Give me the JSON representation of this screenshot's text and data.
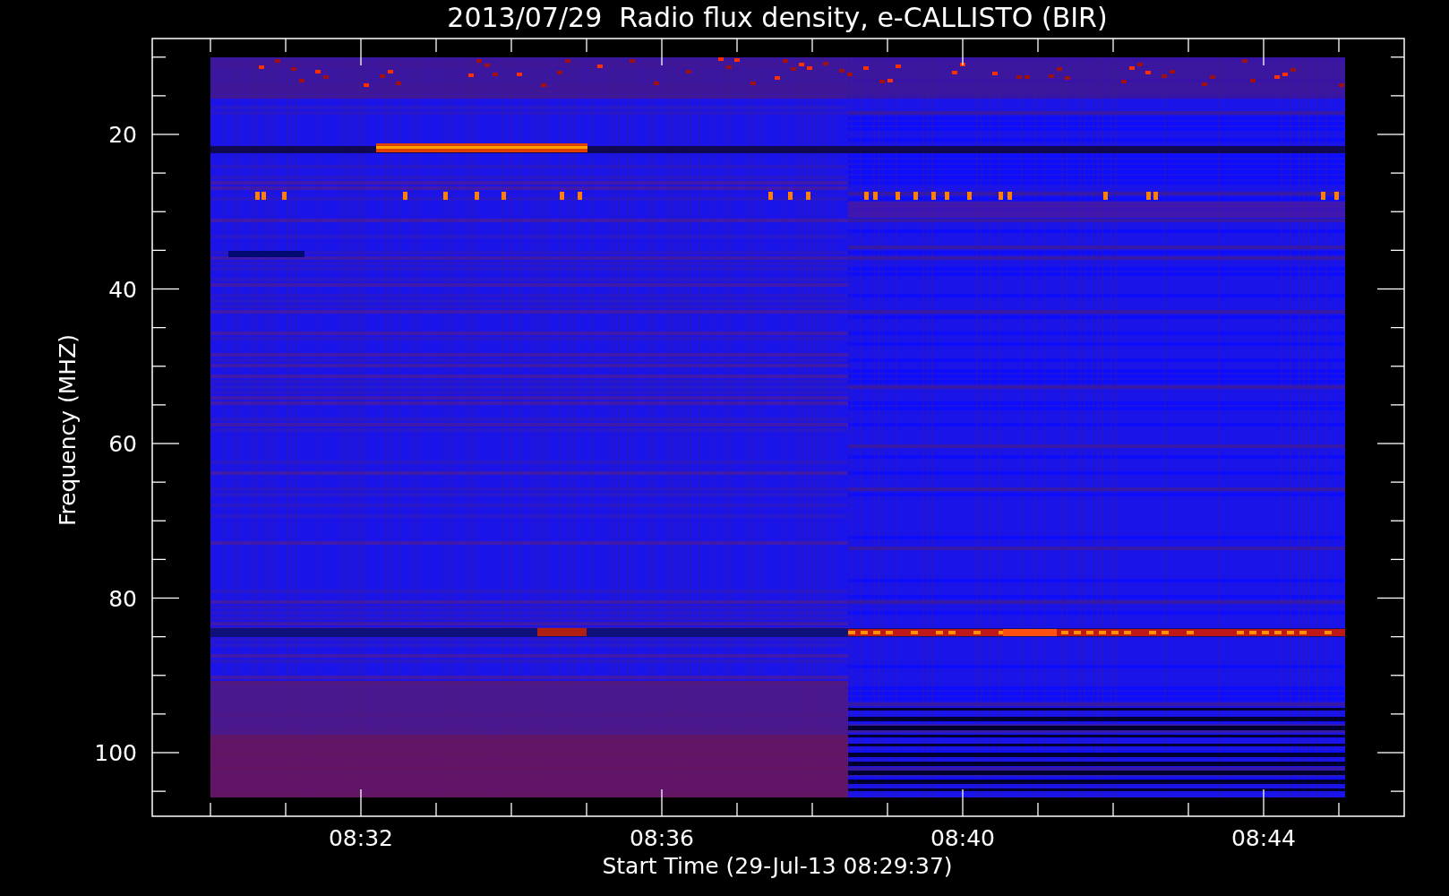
{
  "title": "2013/07/29  Radio flux density, e-CALLISTO (BIR)",
  "y_axis": {
    "label": "Frequency (MHZ)",
    "ticks": [
      "20",
      "40",
      "60",
      "80",
      "100"
    ]
  },
  "x_axis": {
    "label": "Start Time (29-Jul-13 08:29:37)",
    "ticks": [
      "08:32",
      "08:36",
      "08:40",
      "08:44"
    ]
  }
}
